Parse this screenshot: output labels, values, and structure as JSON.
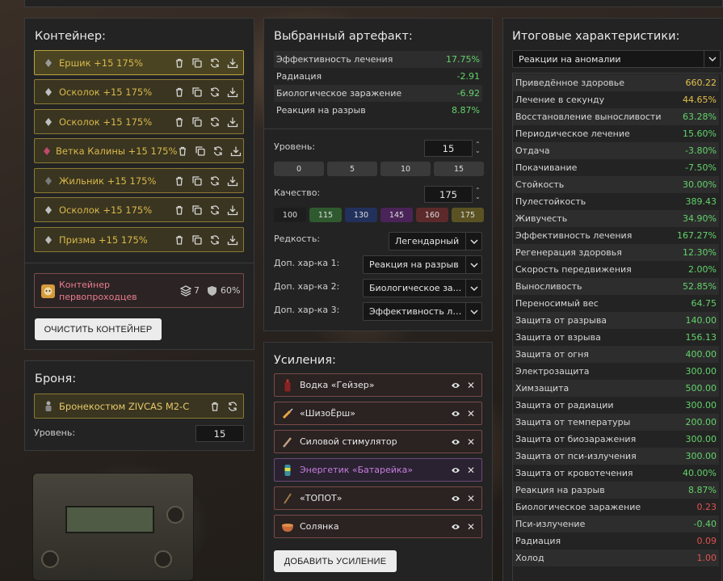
{
  "container": {
    "title": "Контейнер:",
    "slots": [
      {
        "name": "Ершик +15 175%",
        "icon": "urchin-artifact-icon"
      },
      {
        "name": "Осколок +15 175%",
        "icon": "shard-artifact-icon"
      },
      {
        "name": "Осколок +15 175%",
        "icon": "shard-artifact-icon"
      },
      {
        "name": "Ветка Калины +15 175%",
        "icon": "viburnum-branch-icon"
      },
      {
        "name": "Жильник +15 175%",
        "icon": "vein-artifact-icon"
      },
      {
        "name": "Осколок +15 175%",
        "icon": "shard-artifact-icon"
      },
      {
        "name": "Призма +15 175%",
        "icon": "prism-artifact-icon"
      }
    ],
    "type": {
      "name": "Контейнер первопроходцев",
      "slots_count": "7",
      "protection": "60%"
    },
    "clear_label": "ОЧИСТИТЬ КОНТЕЙНЕР"
  },
  "armor": {
    "title": "Броня:",
    "name": "Бронекостюм ZIVCAS M2-C",
    "level_label": "Уровень:",
    "level": "15"
  },
  "artifact": {
    "title": "Выбранный артефакт:",
    "stats": [
      {
        "label": "Эффективность лечения",
        "value": "17.75%",
        "color": "green"
      },
      {
        "label": "Радиация",
        "value": "-2.91",
        "color": "green"
      },
      {
        "label": "Биологическое заражение",
        "value": "-6.92",
        "color": "green"
      },
      {
        "label": "Реакция на разрыв",
        "value": "8.87%",
        "color": "green"
      }
    ],
    "level_label": "Уровень:",
    "level": "15",
    "level_presets": [
      "0",
      "5",
      "10",
      "15"
    ],
    "quality_label": "Качество:",
    "quality": "175",
    "quality_presets": [
      {
        "value": "100",
        "color": "#1d1d1d"
      },
      {
        "value": "115",
        "color": "#2f5a2f"
      },
      {
        "value": "130",
        "color": "#22305c"
      },
      {
        "value": "145",
        "color": "#4a2458"
      },
      {
        "value": "160",
        "color": "#5c2a2a"
      },
      {
        "value": "175",
        "color": "#5a5222"
      }
    ],
    "rarity_label": "Редкость:",
    "rarity": "Легендарный",
    "extra1_label": "Доп. хар-ка 1:",
    "extra1": "Реакция на разрыв",
    "extra2_label": "Доп. хар-ка 2:",
    "extra2": "Биологическое за...",
    "extra3_label": "Доп. хар-ка 3:",
    "extra3": "Эффективность ле..."
  },
  "boosts": {
    "title": "Усиления:",
    "items": [
      {
        "name": "Водка «Гейзер»",
        "icon": "vodka-bottle-icon",
        "style": "red"
      },
      {
        "name": "«ШизоЁрш»",
        "icon": "syringe-icon",
        "style": "red"
      },
      {
        "name": "Силовой стимулятор",
        "icon": "stimulator-syringe-icon",
        "style": "red"
      },
      {
        "name": "Энергетик «Батарейка»",
        "icon": "energy-drink-icon",
        "style": "purple"
      },
      {
        "name": "«ТОПОТ»",
        "icon": "stick-icon",
        "style": "red"
      },
      {
        "name": "Солянка",
        "icon": "soup-bowl-icon",
        "style": "red"
      }
    ],
    "add_label": "ДОБАВИТЬ УСИЛЕНИЕ"
  },
  "totals": {
    "title": "Итоговые характеристики:",
    "filter": "Реакции на аномалии",
    "rows": [
      {
        "label": "Приведённое здоровье",
        "value": "660.22",
        "color": "yellow"
      },
      {
        "label": "Лечение в секунду",
        "value": "44.65%",
        "color": "yellow"
      },
      {
        "label": "Восстановление выносливости",
        "value": "63.28%",
        "color": "green"
      },
      {
        "label": "Периодическое лечение",
        "value": "15.60%",
        "color": "green"
      },
      {
        "label": "Отдача",
        "value": "-3.80%",
        "color": "green"
      },
      {
        "label": "Покачивание",
        "value": "-7.50%",
        "color": "green"
      },
      {
        "label": "Стойкость",
        "value": "30.00%",
        "color": "green"
      },
      {
        "label": "Пулестойкость",
        "value": "389.43",
        "color": "green"
      },
      {
        "label": "Живучесть",
        "value": "34.90%",
        "color": "green"
      },
      {
        "label": "Эффективность лечения",
        "value": "167.27%",
        "color": "green"
      },
      {
        "label": "Регенерация здоровья",
        "value": "12.30%",
        "color": "green"
      },
      {
        "label": "Скорость передвижения",
        "value": "2.00%",
        "color": "green"
      },
      {
        "label": "Выносливость",
        "value": "52.85%",
        "color": "green"
      },
      {
        "label": "Переносимый вес",
        "value": "64.75",
        "color": "green"
      },
      {
        "label": "Защита от разрыва",
        "value": "140.00",
        "color": "green"
      },
      {
        "label": "Защита от взрыва",
        "value": "156.13",
        "color": "green"
      },
      {
        "label": "Защита от огня",
        "value": "400.00",
        "color": "green"
      },
      {
        "label": "Электрозащита",
        "value": "300.00",
        "color": "green"
      },
      {
        "label": "Химзащита",
        "value": "500.00",
        "color": "green"
      },
      {
        "label": "Защита от радиации",
        "value": "300.00",
        "color": "green"
      },
      {
        "label": "Защита от температуры",
        "value": "200.00",
        "color": "green"
      },
      {
        "label": "Защита от биозаражения",
        "value": "300.00",
        "color": "green"
      },
      {
        "label": "Защита от пси-излучения",
        "value": "300.00",
        "color": "green"
      },
      {
        "label": "Защита от кровотечения",
        "value": "40.00%",
        "color": "green"
      },
      {
        "label": "Реакция на разрыв",
        "value": "8.87%",
        "color": "green"
      },
      {
        "label": "Биологическое заражение",
        "value": "0.23",
        "color": "red"
      },
      {
        "label": "Пси-излучение",
        "value": "-0.40",
        "color": "green"
      },
      {
        "label": "Радиация",
        "value": "0.09",
        "color": "red"
      },
      {
        "label": "Холод",
        "value": "1.00",
        "color": "red"
      }
    ]
  }
}
